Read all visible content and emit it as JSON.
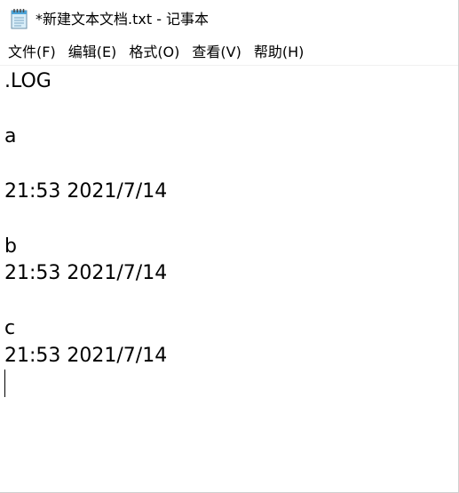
{
  "window": {
    "title": "*新建文本文档.txt - 记事本"
  },
  "menu": {
    "items": [
      "文件(F)",
      "编辑(E)",
      "格式(O)",
      "查看(V)",
      "帮助(H)"
    ]
  },
  "editor": {
    "lines": [
      ".LOG",
      "",
      "a",
      "",
      "21:53 2021/7/14",
      "",
      "b",
      "21:53 2021/7/14",
      "",
      "c",
      "21:53 2021/7/14",
      ""
    ]
  },
  "colors": {
    "text": "#000000",
    "background": "#ffffff"
  },
  "icons": {
    "app": "notepad-icon"
  }
}
